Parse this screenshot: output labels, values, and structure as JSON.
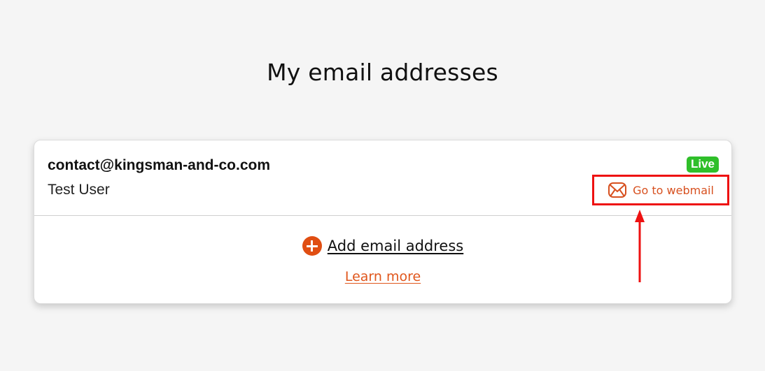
{
  "page": {
    "title": "My email addresses"
  },
  "mailbox": {
    "email": "contact@kingsman-and-co.com",
    "user_name": "Test User",
    "status": "Live",
    "webmail_label": "Go to webmail",
    "webmail_icon": "envelope-icon"
  },
  "actions": {
    "add_label": "Add email address",
    "add_icon": "plus-circle-icon",
    "learn_more_label": "Learn more"
  },
  "colors": {
    "accent": "#e04e12",
    "live_badge": "#2fbf2a",
    "annotation": "#ee1111"
  }
}
